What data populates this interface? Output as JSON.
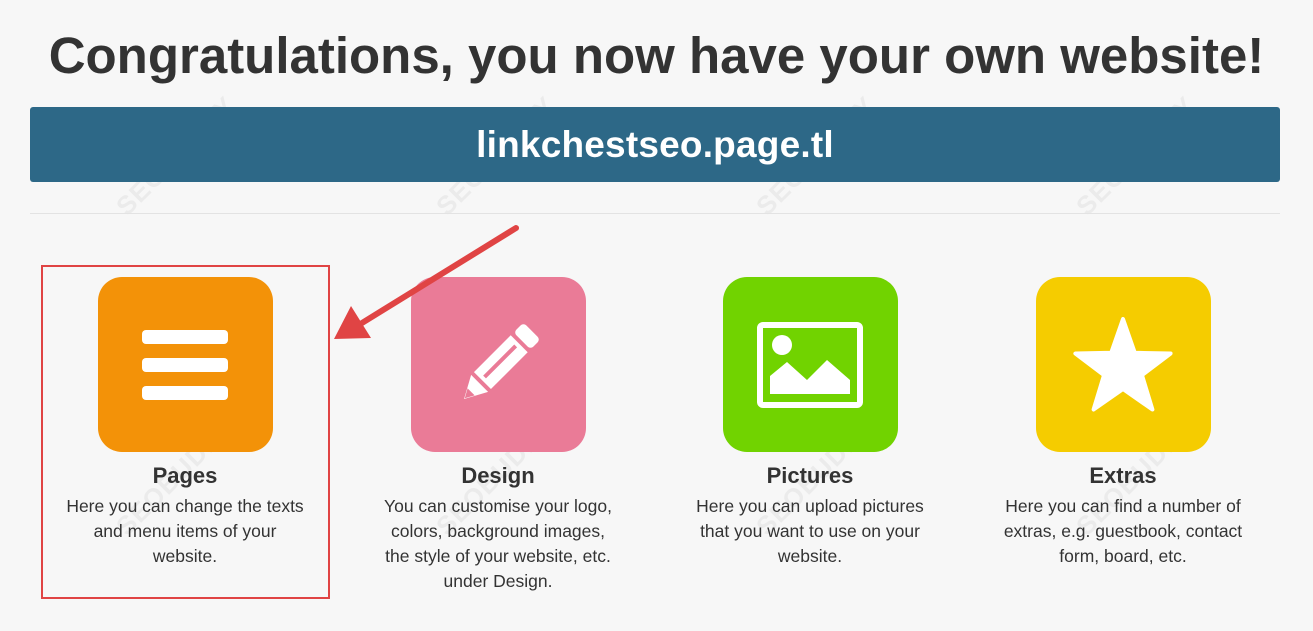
{
  "header": {
    "title": "Congratulations, you now have your own website!",
    "domain": "linkchestseo.page.tl"
  },
  "features": [
    {
      "title": "Pages",
      "description": "Here you can change the texts and menu items of your website.",
      "icon": "list-icon",
      "color": "#f39208"
    },
    {
      "title": "Design",
      "description": "You can customise your logo, colors, background images, the style of your website, etc. under Design.",
      "icon": "pencil-icon",
      "color": "#ea7b97"
    },
    {
      "title": "Pictures",
      "description": "Here you can upload pictures that you want to use on your website.",
      "icon": "image-icon",
      "color": "#71d300"
    },
    {
      "title": "Extras",
      "description": "Here you can find a number of extras, e.g. guestbook, contact form, board, etc.",
      "icon": "star-icon",
      "color": "#f5cc00"
    }
  ],
  "watermark": "SEOBUDDY",
  "annotation": {
    "color": "#e04444"
  }
}
